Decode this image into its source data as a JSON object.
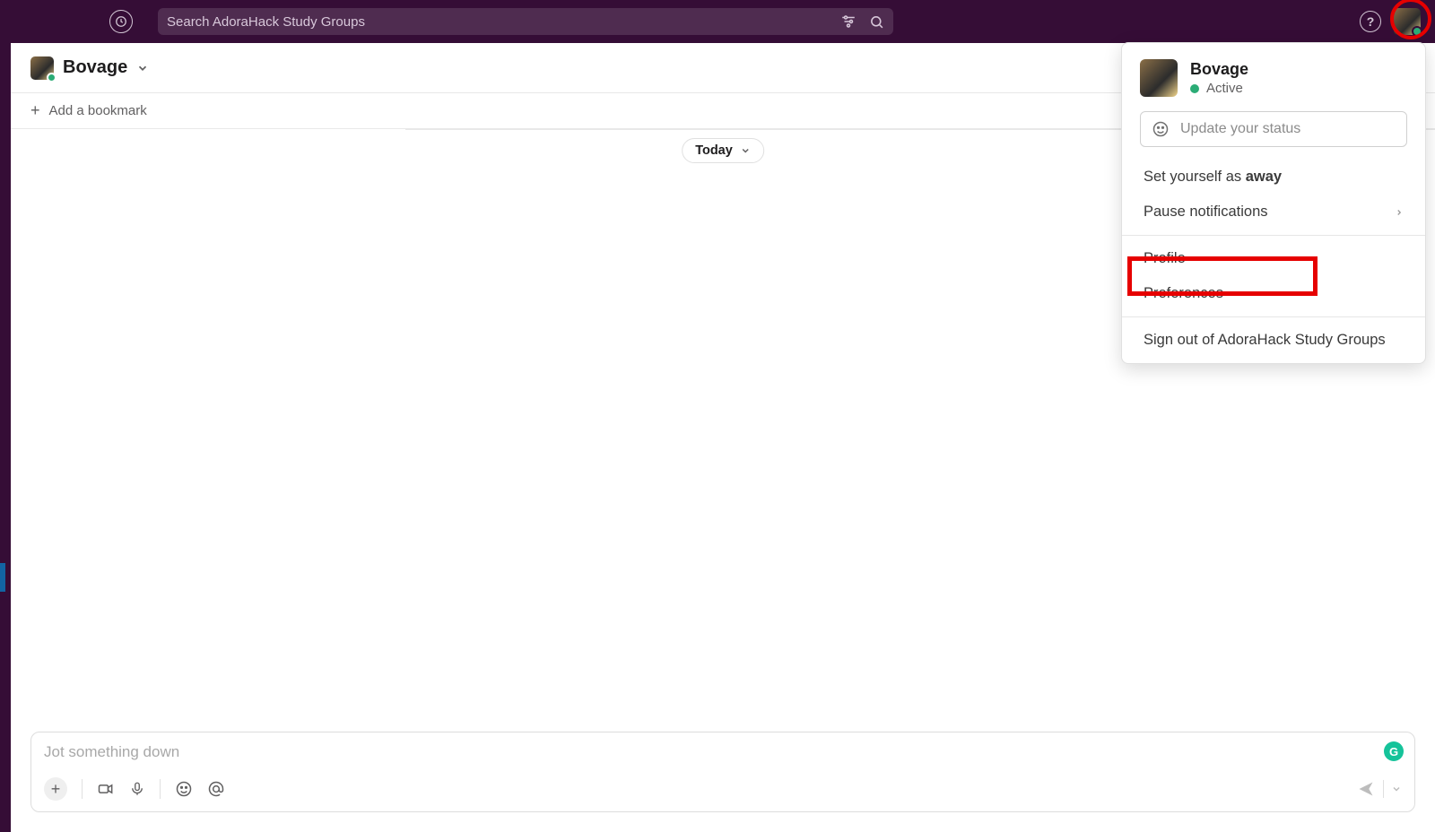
{
  "topbar": {
    "search_placeholder": "Search AdoraHack Study Groups",
    "help": "?"
  },
  "channel": {
    "title": "Bovage",
    "add_bookmark": "Add a bookmark",
    "date_pill": "Today"
  },
  "composer": {
    "placeholder": "Jot something down"
  },
  "user_menu": {
    "name": "Bovage",
    "status_label": "Active",
    "update_status": "Update your status",
    "set_away_prefix": "Set yourself as ",
    "set_away_bold": "away",
    "pause_notifications": "Pause notifications",
    "profile": "Profile",
    "preferences": "Preferences",
    "sign_out": "Sign out of AdoraHack Study Groups"
  }
}
